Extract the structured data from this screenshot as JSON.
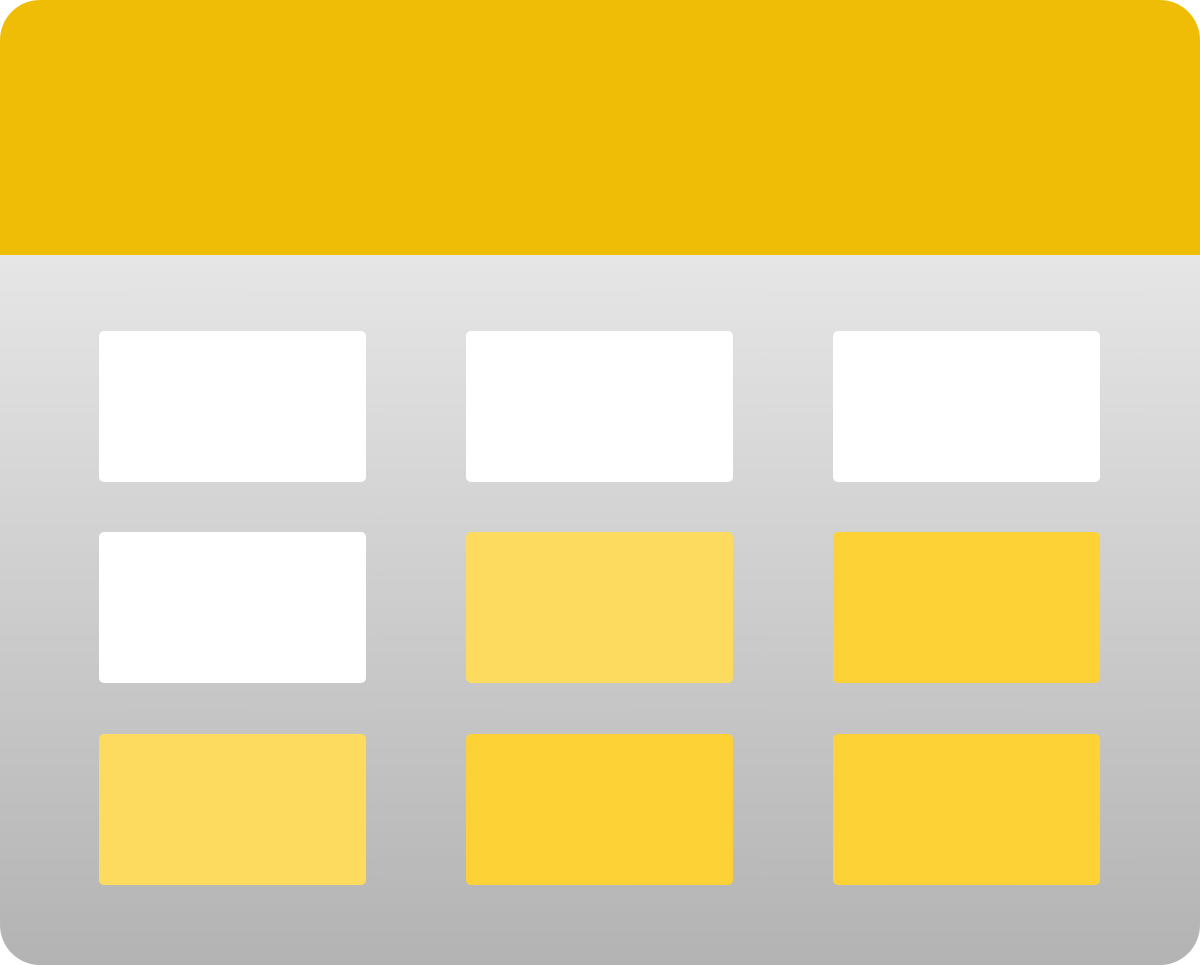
{
  "icon": {
    "name": "table-storage-icon",
    "colors": {
      "header": "#f0bd06",
      "body_top": "#e6e6e6",
      "body_bottom": "#b3b3b3",
      "cell_white": "#ffffff",
      "cell_pale_yellow": "#fddb5e",
      "cell_yellow": "#fdd236"
    },
    "grid": {
      "rows": 3,
      "columns": 3,
      "cell_fills": [
        [
          "white",
          "white",
          "white"
        ],
        [
          "white",
          "pale_yellow",
          "yellow"
        ],
        [
          "pale_yellow",
          "yellow",
          "yellow"
        ]
      ]
    }
  }
}
